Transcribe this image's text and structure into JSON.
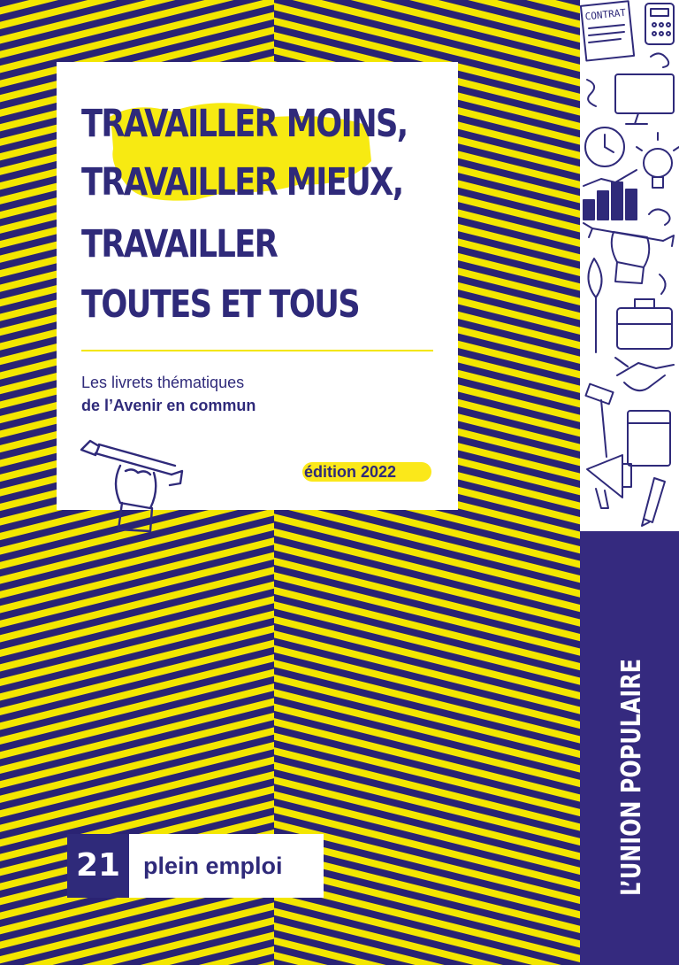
{
  "title": {
    "lines": [
      "TRAVAILLER MOINS,",
      "TRAVAILLER MIEUX,",
      "TRAVAILLER",
      "TOUTES ET TOUS"
    ]
  },
  "subtitle": {
    "line1": "Les livrets thématiques",
    "line2": "de l’Avenir en commun"
  },
  "edition": "édition 2022",
  "booklet": {
    "number": "21",
    "topic": "plein emploi"
  },
  "publisher": "L’UNION POPULAIRE",
  "doodles": {
    "contract_label": "CONTRAT"
  },
  "colors": {
    "purple": "#2f2a7a",
    "yellow": "#f3e600",
    "white": "#ffffff"
  }
}
